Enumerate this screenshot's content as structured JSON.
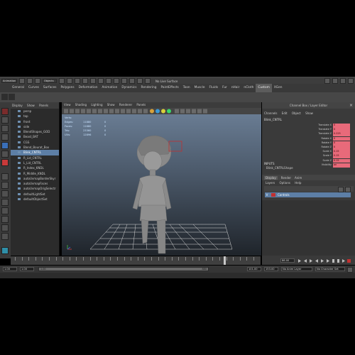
{
  "app": {
    "mode_label": "Animation",
    "mode_selector": "Objects",
    "no_live_surface": "No Live Surface"
  },
  "shelf_tabs": [
    "General",
    "Curves",
    "Surfaces",
    "Polygons",
    "Deformation",
    "Animation",
    "Dynamics",
    "Rendering",
    "PaintEffects",
    "Toon",
    "Muscle",
    "Fluids",
    "Fur",
    "nHair",
    "nCloth",
    "Custom",
    "XGen"
  ],
  "shelf_active": "Custom",
  "outliner": {
    "menu": [
      "Display",
      "Show",
      "Panels"
    ],
    "items": [
      {
        "label": "persp",
        "selected": false
      },
      {
        "label": "top",
        "selected": false
      },
      {
        "label": "front",
        "selected": false
      },
      {
        "label": "side",
        "selected": false
      },
      {
        "label": "BlendShapes_GOD",
        "selected": false
      },
      {
        "label": "Beast_BAT",
        "selected": false
      },
      {
        "label": "CGS",
        "selected": false
      },
      {
        "label": "Blend_Bourat_Box",
        "selected": false
      },
      {
        "label": "Blink_CNTRL",
        "selected": true
      },
      {
        "label": "R_Lid_CNTRL",
        "selected": false
      },
      {
        "label": "L_Lid_CNTRL",
        "selected": false
      },
      {
        "label": "R_Index_KNDL",
        "selected": false
      },
      {
        "label": "R_Middle_KNDL",
        "selected": false
      },
      {
        "label": "autoUvmapBorderSkyr",
        "selected": false
      },
      {
        "label": "autoUvmapFaces",
        "selected": false
      },
      {
        "label": "autoUvmapOrigSelectr",
        "selected": false
      },
      {
        "label": "defaultLightSet",
        "selected": false
      },
      {
        "label": "defaultObjectSet",
        "selected": false
      }
    ]
  },
  "viewport": {
    "menu": [
      "View",
      "Shading",
      "Lighting",
      "Show",
      "Renderer",
      "Panels"
    ],
    "hud": [
      {
        "k": "Verts:",
        "v": "",
        "v2": ""
      },
      {
        "k": "Edges:",
        "v": "11880",
        "v2": "0"
      },
      {
        "k": "Faces:",
        "v": "11680",
        "v2": "0"
      },
      {
        "k": "Tris:",
        "v": "23360",
        "v2": "0"
      },
      {
        "k": "UVs:",
        "v": "12896",
        "v2": "0"
      }
    ]
  },
  "channel_box": {
    "title": "Channel Box / Layer Editor",
    "menu": [
      "Channels",
      "Edit",
      "Object",
      "Show"
    ],
    "object_name": "Blink_CNTRL",
    "attributes": [
      {
        "name": "Translate X",
        "value": "0"
      },
      {
        "name": "Translate Y",
        "value": "0"
      },
      {
        "name": "Translate Z",
        "value": "0.225"
      },
      {
        "name": "Rotate X",
        "value": "0"
      },
      {
        "name": "Rotate Y",
        "value": "0"
      },
      {
        "name": "Rotate Z",
        "value": "0"
      },
      {
        "name": "Scale X",
        "value": "0.15"
      },
      {
        "name": "Scale Y",
        "value": "0.15"
      },
      {
        "name": "Scale Z",
        "value": "0.15"
      },
      {
        "name": "Visibility",
        "value": "on"
      }
    ],
    "inputs_label": "INPUTS",
    "inputs_item": "Blink_CNTRLShape",
    "layer_tabs": [
      "Display",
      "Render",
      "Anim"
    ],
    "layer_tab_active": "Display",
    "layer_menu": [
      "Layers",
      "Options",
      "Help"
    ],
    "layer_name": "Controls",
    "layer_letter": "V"
  },
  "time": {
    "current_frame": "86.00",
    "range_start": "1.00",
    "range_inner_start": "1.00",
    "range_inner_end": "880",
    "range_end": "101.00",
    "anim_end": "153.00",
    "anim_layer": "No Anim Layer",
    "char_set": "No Character Set"
  },
  "colors": {
    "selection": "#5d7fa6",
    "keyed_attr": "#e86a7a",
    "highlight": "#c03030"
  }
}
